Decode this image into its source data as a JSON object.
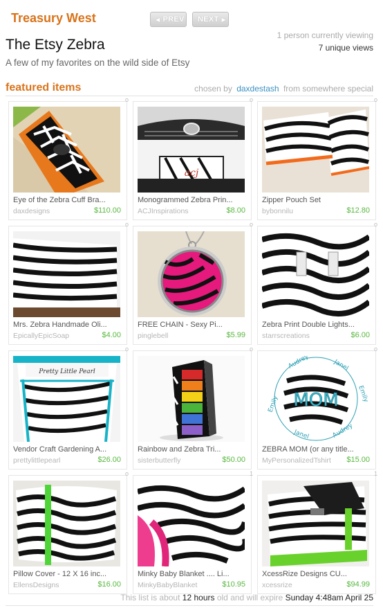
{
  "header": {
    "site_title": "Treasury West",
    "prev_label": "PREV",
    "next_label": "NEXT",
    "viewing_text": "1 person currently viewing",
    "views_text": "7 unique views"
  },
  "list": {
    "title": "The Etsy Zebra",
    "description": "A few of my favorites on the wild side of Etsy"
  },
  "featured": {
    "heading": "featured items",
    "chosen_by": "chosen by",
    "curator": "daxdestash",
    "from": "from",
    "location": "somewhere special"
  },
  "items": [
    {
      "title": "Eye of the Zebra Cuff Bra...",
      "shop": "daxdesigns",
      "price": "$110.00",
      "marker": "o"
    },
    {
      "title": "Monogrammed Zebra Prin...",
      "shop": "ACJInspirations",
      "price": "$8.00",
      "marker": "o"
    },
    {
      "title": "Zipper Pouch Set",
      "shop": "bybonnilu",
      "price": "$12.80",
      "marker": "o"
    },
    {
      "title": "Mrs. Zebra Handmade Oli...",
      "shop": "EpicallyEpicSoap",
      "price": "$4.00",
      "marker": "o"
    },
    {
      "title": "FREE CHAIN - Sexy Pi...",
      "shop": "pinglebell",
      "price": "$5.99",
      "marker": "o"
    },
    {
      "title": "Zebra Print Double Lights...",
      "shop": "starrscreations",
      "price": "$6.00",
      "marker": "o"
    },
    {
      "title": "Vendor Craft Gardening A...",
      "shop": "prettylittlepearl",
      "price": "$26.00",
      "marker": "o"
    },
    {
      "title": "Rainbow and Zebra  Tri...",
      "shop": "sisterbutterfly",
      "price": "$50.00",
      "marker": "o"
    },
    {
      "title": "ZEBRA MOM (or any title...",
      "shop": "MyPersonalizedTshirt",
      "price": "$15.00",
      "marker": "o"
    },
    {
      "title": "Pillow Cover - 12 X 16 inc...",
      "shop": "EllensDesigns",
      "price": "$16.00",
      "marker": "o"
    },
    {
      "title": "Minky Baby Blanket .... Li...",
      "shop": "MinkyBabyBlanket",
      "price": "$10.95",
      "marker": "1"
    },
    {
      "title": "XcessRize Designs CU...",
      "shop": "xcessrize",
      "price": "$94.99",
      "marker": "1"
    }
  ],
  "thumb_text": {
    "mom": "MOM",
    "ring_1": "Emily",
    "ring_2": "Audrey",
    "ring_3": "Janel",
    "bag_text": "Pretty Little Pearl"
  },
  "footer": {
    "prefix": "This list is about",
    "duration": "12 hours",
    "middle": "old and will expire",
    "expiry": "Sunday 4:48am  April 25"
  },
  "colors": {
    "accent": "#d9731a",
    "link": "#3a8fc2",
    "price": "#59b840"
  }
}
